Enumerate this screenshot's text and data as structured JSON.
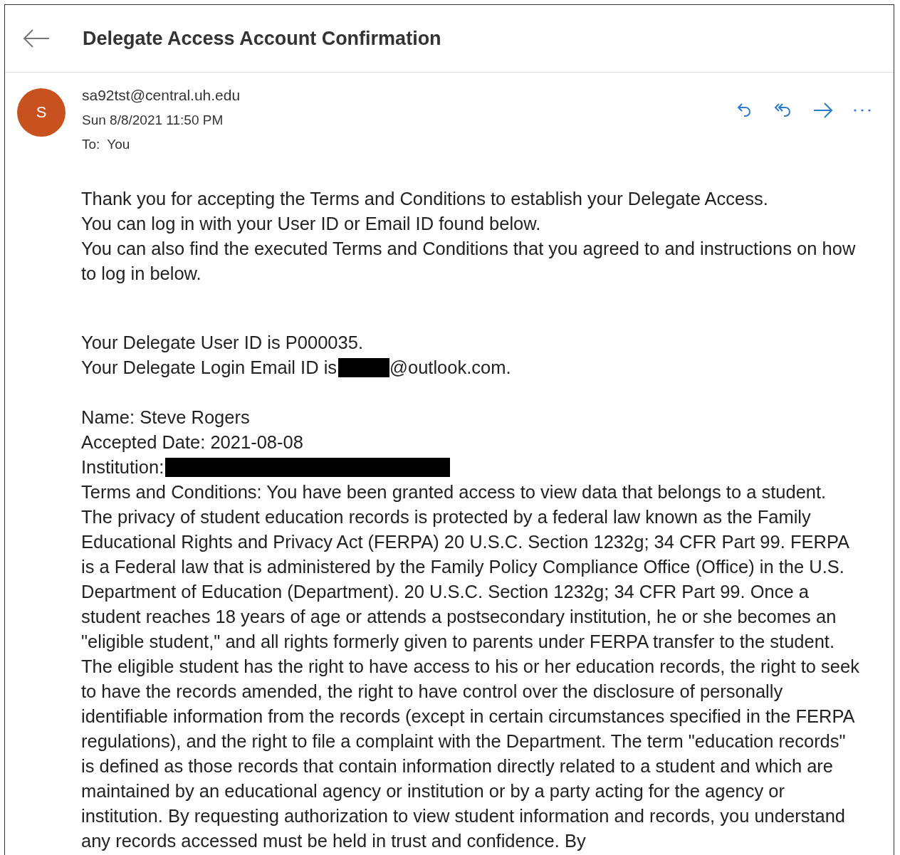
{
  "header": {
    "title": "Delegate Access Account Confirmation"
  },
  "message": {
    "avatar_initial": "S",
    "sender": "sa92tst@central.uh.edu",
    "date": "Sun 8/8/2021 11:50 PM",
    "to_label": "To:",
    "to": "You"
  },
  "body": {
    "intro": [
      "Thank you for accepting the Terms and Conditions to establish your Delegate Access.",
      "You can log in with your User ID or Email ID found below.",
      "You can also find the executed Terms and Conditions that you agreed to and instructions on how to log in below."
    ],
    "user_id_line": "Your Delegate User ID is P000035.",
    "email_line": {
      "before": "Your Delegate Login Email ID is",
      "redacted": true,
      "after": "@outlook.com."
    },
    "fields": [
      {
        "text": "Name: Steve Rogers",
        "redacted": false
      },
      {
        "text": "Accepted Date: 2021-08-08",
        "redacted": false
      },
      {
        "text": "Institution:",
        "redacted": true
      }
    ],
    "terms": "Terms and Conditions: You have been granted access to view data that belongs to a student. The privacy of student education records is protected by a federal law known as the Family Educational Rights and Privacy Act (FERPA) 20 U.S.C. Section 1232g; 34 CFR Part 99. FERPA is a Federal law that is administered by the Family Policy Compliance Office (Office) in the U.S. Department of Education (Department). 20 U.S.C. Section 1232g; 34 CFR Part 99. Once a student reaches 18 years of age or attends a postsecondary institution, he or she becomes an \"eligible student,\" and all rights formerly given to parents under FERPA transfer to the student. The eligible student has the right to have access to his or her education records, the right to seek to have the records amended, the right to have control over the disclosure of personally identifiable information from the records (except in certain circumstances specified in the FERPA regulations), and the right to file a complaint with the Department. The term \"education records\" is defined as those records that contain information directly related to a student and which are maintained by an educational agency or institution or by a party acting for the agency or institution. By requesting authorization to view student information and records, you understand any records accessed must be held in trust and confidence. By"
  }
}
